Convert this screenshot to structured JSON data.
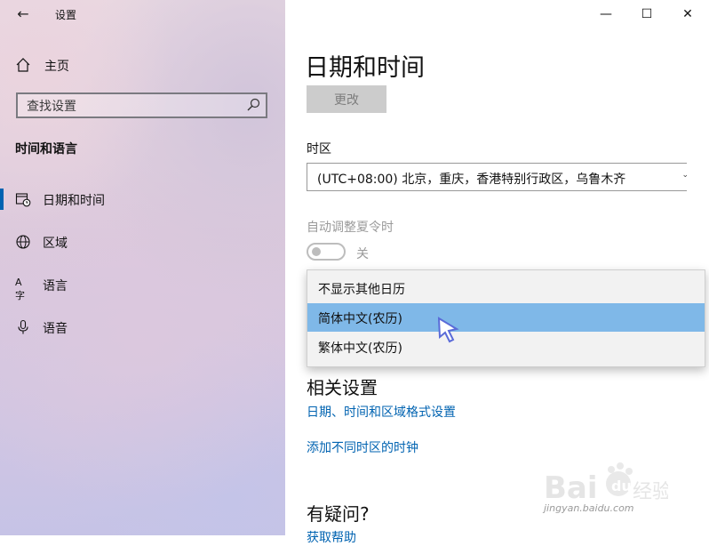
{
  "app": {
    "title": "设置",
    "back_label": "←"
  },
  "window_controls": {
    "minimize": "—",
    "maximize": "☐",
    "close": "✕"
  },
  "sidebar": {
    "home_label": "主页",
    "search_placeholder": "查找设置",
    "section_title": "时间和语言",
    "items": [
      {
        "label": "日期和时间",
        "icon": "clock-calendar-icon",
        "active": true
      },
      {
        "label": "区域",
        "icon": "globe-icon",
        "active": false
      },
      {
        "label": "语言",
        "icon": "language-icon",
        "glyph": "A字",
        "active": false
      },
      {
        "label": "语音",
        "icon": "microphone-icon",
        "active": false
      }
    ]
  },
  "main": {
    "page_title": "日期和时间",
    "change_button": "更改",
    "timezone_label": "时区",
    "timezone_value": "(UTC+08:00) 北京，重庆，香港特别行政区，乌鲁木齐",
    "dst_label": "自动调整夏令时",
    "dst_state": "关",
    "calendar_dropdown": {
      "options": [
        "不显示其他日历",
        "简体中文(农历)",
        "繁体中文(农历)"
      ],
      "selected_index": 1
    },
    "related_title": "相关设置",
    "related_links": [
      "日期、时间和区域格式设置",
      "添加不同时区的时钟"
    ],
    "question_title": "有疑问?",
    "help_link": "获取帮助"
  },
  "colors": {
    "accent": "#0063b1",
    "selection": "#7fb8e8",
    "disabled_text": "#9a9a9a"
  },
  "watermark": {
    "text": "jingyan.baidu.com",
    "logo": "Bai du 经验"
  }
}
